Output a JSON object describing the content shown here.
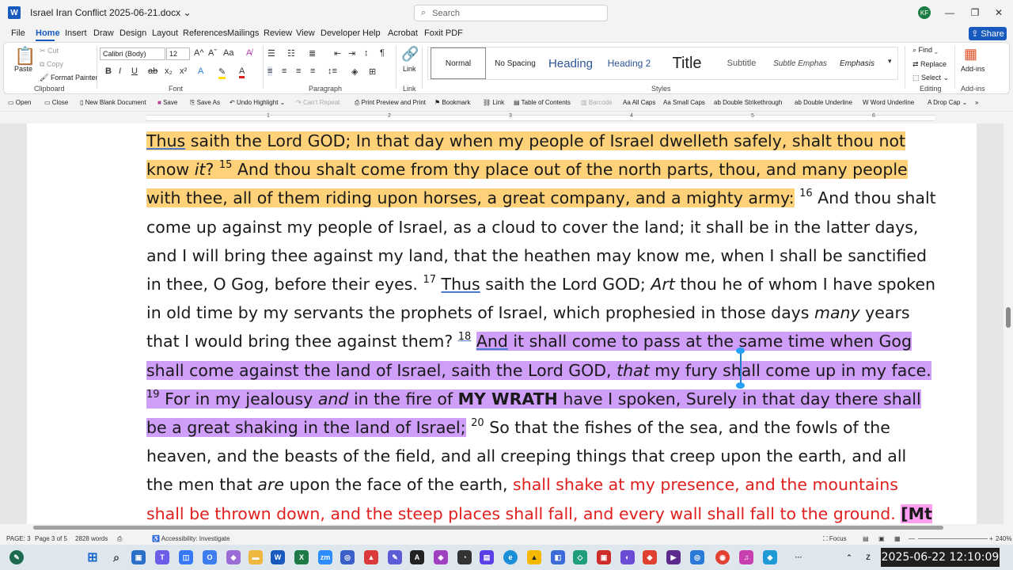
{
  "titlebar": {
    "doc_title": "Israel Iran Conflict 2025-06-21.docx",
    "search_placeholder": "Search",
    "avatar_initials": "KF"
  },
  "menu": [
    "File",
    "Home",
    "Insert",
    "Draw",
    "Design",
    "Layout",
    "References",
    "Mailings",
    "Review",
    "View",
    "Developer",
    "Help",
    "Acrobat",
    "Foxit PDF"
  ],
  "share_label": "Share",
  "ribbon": {
    "clipboard": {
      "paste": "Paste",
      "cut": "Cut",
      "copy": "Copy",
      "format_painter": "Format Painter",
      "label": "Clipboard"
    },
    "font": {
      "name": "Calibri (Body)",
      "size": "12",
      "label": "Font"
    },
    "paragraph_label": "Paragraph",
    "link": {
      "label": "Link",
      "group": "Link"
    },
    "styles": {
      "items": [
        "Normal",
        "No Spacing",
        "Heading",
        "Heading 2",
        "Title",
        "Subtitle",
        "Subtle Emphas",
        "Emphasis"
      ],
      "label": "Styles"
    },
    "editing": {
      "find": "Find",
      "replace": "Replace",
      "select": "Select",
      "label": "Editing"
    },
    "addins": {
      "label": "Add-ins",
      "group": "Add-ins"
    }
  },
  "quick_toolbar": [
    "Open",
    "Close",
    "New Blank Document",
    "Save",
    "Save As",
    "Undo Highlight",
    "Can't Repeat",
    "Print Preview and Print",
    "Bookmark",
    "Link",
    "Table of Contents",
    "Barcode",
    "All Caps",
    "Small Caps",
    "Double Strikethrough",
    "Double Underline",
    "Word Underline",
    "Drop Cap"
  ],
  "ruler_numbers": [
    "1",
    "2",
    "3",
    "4",
    "5",
    "6"
  ],
  "document": {
    "l1_a": "Thus",
    "l1_b": " saith the Lord GOD; In that day when my people of Israel dwelleth safely, shalt thou not know ",
    "l1_it": "it",
    "l1_c": "? ",
    "v15": "15",
    "l2": " And thou shalt come from thy place out of the north parts, thou, and many people with thee, all of them riding upon horses, a great company, and a mighty army:",
    "v16": "16",
    "l3": " And thou shalt come up against my people of Israel, as a cloud to cover the land; it shall be in the latter days, and I will bring thee against my land, that the heathen may know me, when I shall be sanctified in thee, O Gog, before their eyes. ",
    "v17": "17",
    "l4_a": "Thus",
    "l4_b": " saith the Lord GOD; ",
    "l4_it": "Art",
    "l4_c": " thou he of whom I have spoken in old time by my servants the prophets of Israel, which prophesied in those days ",
    "l4_it2": "many",
    "l4_d": " years that I would bring thee against them? ",
    "v18": "18",
    "l5_a": "And",
    "l5_b": " it shall come to pass at the same time when Gog shall come against the land of Israel, saith the Lord GOD, ",
    "l5_it": "that",
    "l5_c": " my fury shall come up in my face. ",
    "v19": "19",
    "l6_a": " For in my jealousy ",
    "l6_it": "and",
    "l6_b": " in the fire of ",
    "l6_bold": "MY WRATH",
    "l6_c": " have I spoken, Surely in that day there shall be a great shaking in the land of Israel;",
    "v20": "20",
    "l7_a": " So that the fishes of the sea, and the fowls of the heaven, and the beasts of the field, and all creeping things that creep upon the earth, and all the men that ",
    "l7_it": "are",
    "l7_b": " upon the face of the earth, ",
    "l7_red": "shall shake at my presence, and the mountains shall be thrown down, and the steep places shall fall, and every wall shall fall to the ground.",
    "l7_ref": "[Mt"
  },
  "statusbar": {
    "page": "PAGE: 3",
    "page_of": "Page 3 of 5",
    "words": "2828 words",
    "accessibility": "Accessibility: Investigate",
    "focus": "Focus",
    "zoom": "240%"
  },
  "clock": "2025-06-22 12:10:09"
}
